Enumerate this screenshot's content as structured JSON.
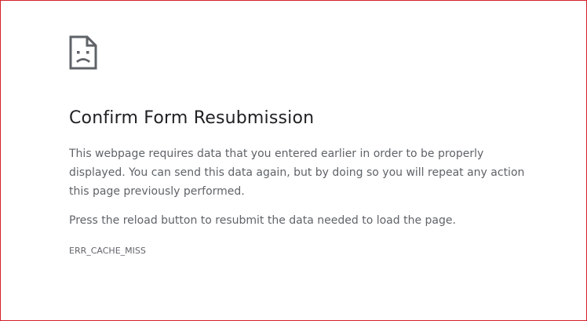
{
  "error_page": {
    "icon": "sad-page-icon",
    "title": "Confirm Form Resubmission",
    "description": "This webpage requires data that you entered earlier in order to be properly displayed. You can send this data again, but by doing so you will repeat any action this page previously performed.",
    "hint": "Press the reload button to resubmit the data needed to load the page.",
    "error_code": "ERR_CACHE_MISS"
  },
  "colors": {
    "frame_border": "#d5202a",
    "title_text": "#202124",
    "body_text": "#5f6368",
    "icon_stroke": "#5f6368"
  }
}
